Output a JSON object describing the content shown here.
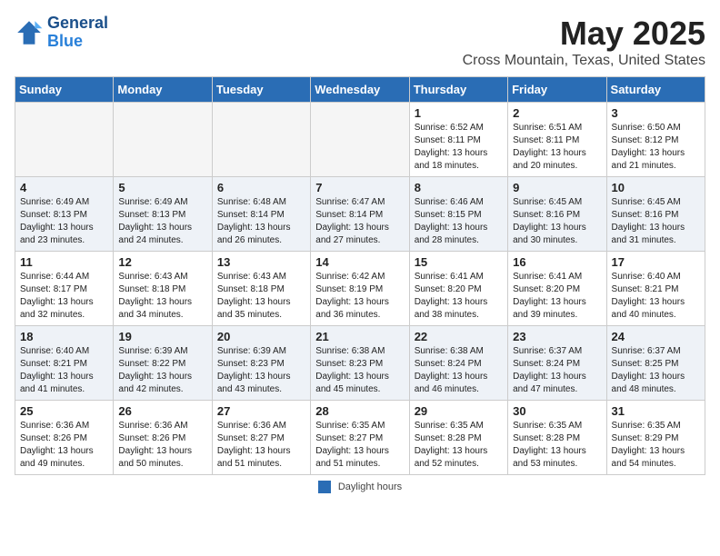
{
  "header": {
    "logo_line1": "General",
    "logo_line2": "Blue",
    "month": "May 2025",
    "location": "Cross Mountain, Texas, United States"
  },
  "days_of_week": [
    "Sunday",
    "Monday",
    "Tuesday",
    "Wednesday",
    "Thursday",
    "Friday",
    "Saturday"
  ],
  "weeks": [
    [
      {
        "day": "",
        "text": "",
        "empty": true
      },
      {
        "day": "",
        "text": "",
        "empty": true
      },
      {
        "day": "",
        "text": "",
        "empty": true
      },
      {
        "day": "",
        "text": "",
        "empty": true
      },
      {
        "day": "1",
        "text": "Sunrise: 6:52 AM\nSunset: 8:11 PM\nDaylight: 13 hours\nand 18 minutes."
      },
      {
        "day": "2",
        "text": "Sunrise: 6:51 AM\nSunset: 8:11 PM\nDaylight: 13 hours\nand 20 minutes."
      },
      {
        "day": "3",
        "text": "Sunrise: 6:50 AM\nSunset: 8:12 PM\nDaylight: 13 hours\nand 21 minutes."
      }
    ],
    [
      {
        "day": "4",
        "text": "Sunrise: 6:49 AM\nSunset: 8:13 PM\nDaylight: 13 hours\nand 23 minutes."
      },
      {
        "day": "5",
        "text": "Sunrise: 6:49 AM\nSunset: 8:13 PM\nDaylight: 13 hours\nand 24 minutes."
      },
      {
        "day": "6",
        "text": "Sunrise: 6:48 AM\nSunset: 8:14 PM\nDaylight: 13 hours\nand 26 minutes."
      },
      {
        "day": "7",
        "text": "Sunrise: 6:47 AM\nSunset: 8:14 PM\nDaylight: 13 hours\nand 27 minutes."
      },
      {
        "day": "8",
        "text": "Sunrise: 6:46 AM\nSunset: 8:15 PM\nDaylight: 13 hours\nand 28 minutes."
      },
      {
        "day": "9",
        "text": "Sunrise: 6:45 AM\nSunset: 8:16 PM\nDaylight: 13 hours\nand 30 minutes."
      },
      {
        "day": "10",
        "text": "Sunrise: 6:45 AM\nSunset: 8:16 PM\nDaylight: 13 hours\nand 31 minutes."
      }
    ],
    [
      {
        "day": "11",
        "text": "Sunrise: 6:44 AM\nSunset: 8:17 PM\nDaylight: 13 hours\nand 32 minutes."
      },
      {
        "day": "12",
        "text": "Sunrise: 6:43 AM\nSunset: 8:18 PM\nDaylight: 13 hours\nand 34 minutes."
      },
      {
        "day": "13",
        "text": "Sunrise: 6:43 AM\nSunset: 8:18 PM\nDaylight: 13 hours\nand 35 minutes."
      },
      {
        "day": "14",
        "text": "Sunrise: 6:42 AM\nSunset: 8:19 PM\nDaylight: 13 hours\nand 36 minutes."
      },
      {
        "day": "15",
        "text": "Sunrise: 6:41 AM\nSunset: 8:20 PM\nDaylight: 13 hours\nand 38 minutes."
      },
      {
        "day": "16",
        "text": "Sunrise: 6:41 AM\nSunset: 8:20 PM\nDaylight: 13 hours\nand 39 minutes."
      },
      {
        "day": "17",
        "text": "Sunrise: 6:40 AM\nSunset: 8:21 PM\nDaylight: 13 hours\nand 40 minutes."
      }
    ],
    [
      {
        "day": "18",
        "text": "Sunrise: 6:40 AM\nSunset: 8:21 PM\nDaylight: 13 hours\nand 41 minutes."
      },
      {
        "day": "19",
        "text": "Sunrise: 6:39 AM\nSunset: 8:22 PM\nDaylight: 13 hours\nand 42 minutes."
      },
      {
        "day": "20",
        "text": "Sunrise: 6:39 AM\nSunset: 8:23 PM\nDaylight: 13 hours\nand 43 minutes."
      },
      {
        "day": "21",
        "text": "Sunrise: 6:38 AM\nSunset: 8:23 PM\nDaylight: 13 hours\nand 45 minutes."
      },
      {
        "day": "22",
        "text": "Sunrise: 6:38 AM\nSunset: 8:24 PM\nDaylight: 13 hours\nand 46 minutes."
      },
      {
        "day": "23",
        "text": "Sunrise: 6:37 AM\nSunset: 8:24 PM\nDaylight: 13 hours\nand 47 minutes."
      },
      {
        "day": "24",
        "text": "Sunrise: 6:37 AM\nSunset: 8:25 PM\nDaylight: 13 hours\nand 48 minutes."
      }
    ],
    [
      {
        "day": "25",
        "text": "Sunrise: 6:36 AM\nSunset: 8:26 PM\nDaylight: 13 hours\nand 49 minutes."
      },
      {
        "day": "26",
        "text": "Sunrise: 6:36 AM\nSunset: 8:26 PM\nDaylight: 13 hours\nand 50 minutes."
      },
      {
        "day": "27",
        "text": "Sunrise: 6:36 AM\nSunset: 8:27 PM\nDaylight: 13 hours\nand 51 minutes."
      },
      {
        "day": "28",
        "text": "Sunrise: 6:35 AM\nSunset: 8:27 PM\nDaylight: 13 hours\nand 51 minutes."
      },
      {
        "day": "29",
        "text": "Sunrise: 6:35 AM\nSunset: 8:28 PM\nDaylight: 13 hours\nand 52 minutes."
      },
      {
        "day": "30",
        "text": "Sunrise: 6:35 AM\nSunset: 8:28 PM\nDaylight: 13 hours\nand 53 minutes."
      },
      {
        "day": "31",
        "text": "Sunrise: 6:35 AM\nSunset: 8:29 PM\nDaylight: 13 hours\nand 54 minutes."
      }
    ]
  ],
  "footer": {
    "legend_label": "Daylight hours"
  }
}
